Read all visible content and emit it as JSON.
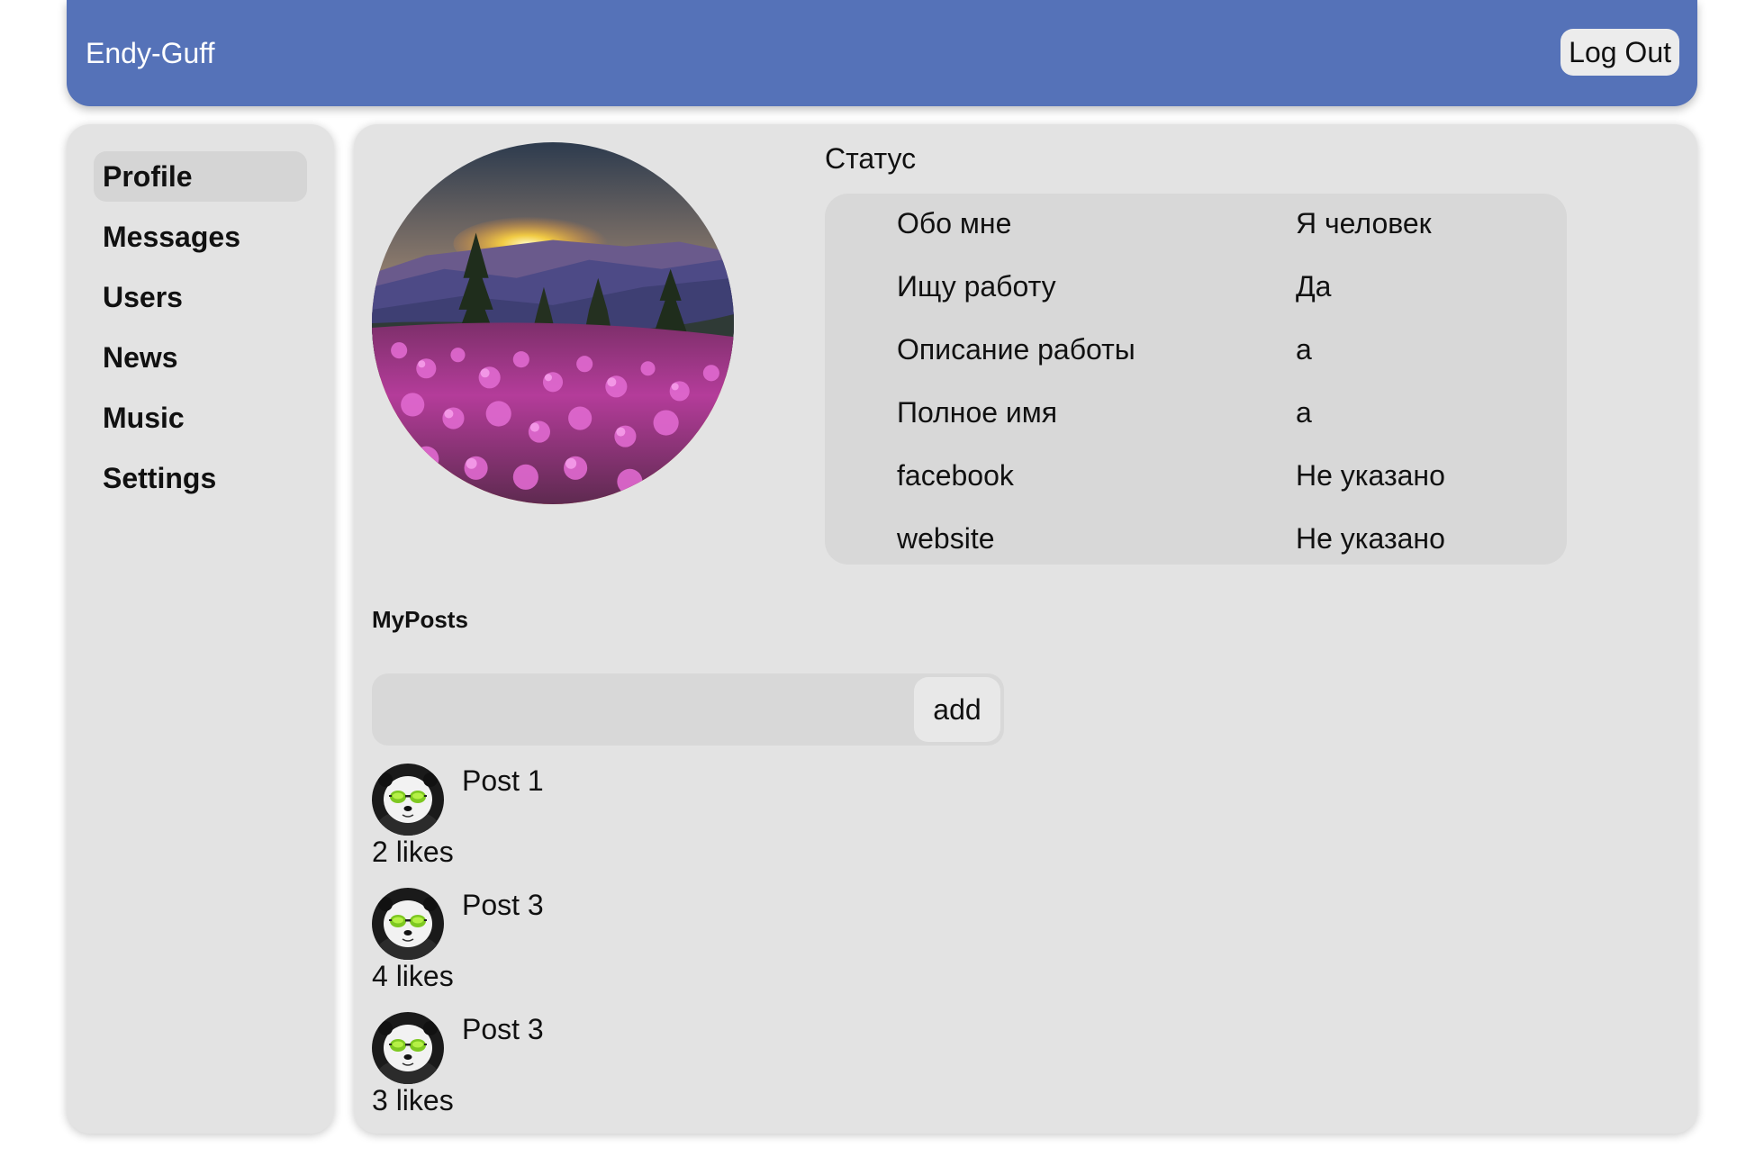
{
  "header": {
    "app_title": "Endy-Guff",
    "logout_label": "Log Out",
    "background_color": "#5572b8"
  },
  "sidebar": {
    "items": [
      {
        "label": "Profile",
        "active": true
      },
      {
        "label": "Messages",
        "active": false
      },
      {
        "label": "Users",
        "active": false
      },
      {
        "label": "News",
        "active": false
      },
      {
        "label": "Music",
        "active": false
      },
      {
        "label": "Settings",
        "active": false
      }
    ]
  },
  "profile": {
    "status": "Статус",
    "info": [
      {
        "label": "Обо мне",
        "value": "Я человек"
      },
      {
        "label": "Ищу работу",
        "value": "Да"
      },
      {
        "label": "Описание работы",
        "value": "a"
      },
      {
        "label": "Полное имя",
        "value": "a"
      },
      {
        "label": "facebook",
        "value": "Не указано"
      },
      {
        "label": "website",
        "value": "Не указано"
      }
    ]
  },
  "posts": {
    "title": "MyPosts",
    "input_value": "",
    "add_label": "add",
    "items": [
      {
        "text": "Post 1",
        "likes": "2 likes"
      },
      {
        "text": "Post 3",
        "likes": "4 likes"
      },
      {
        "text": "Post 3",
        "likes": "3 likes"
      }
    ]
  }
}
